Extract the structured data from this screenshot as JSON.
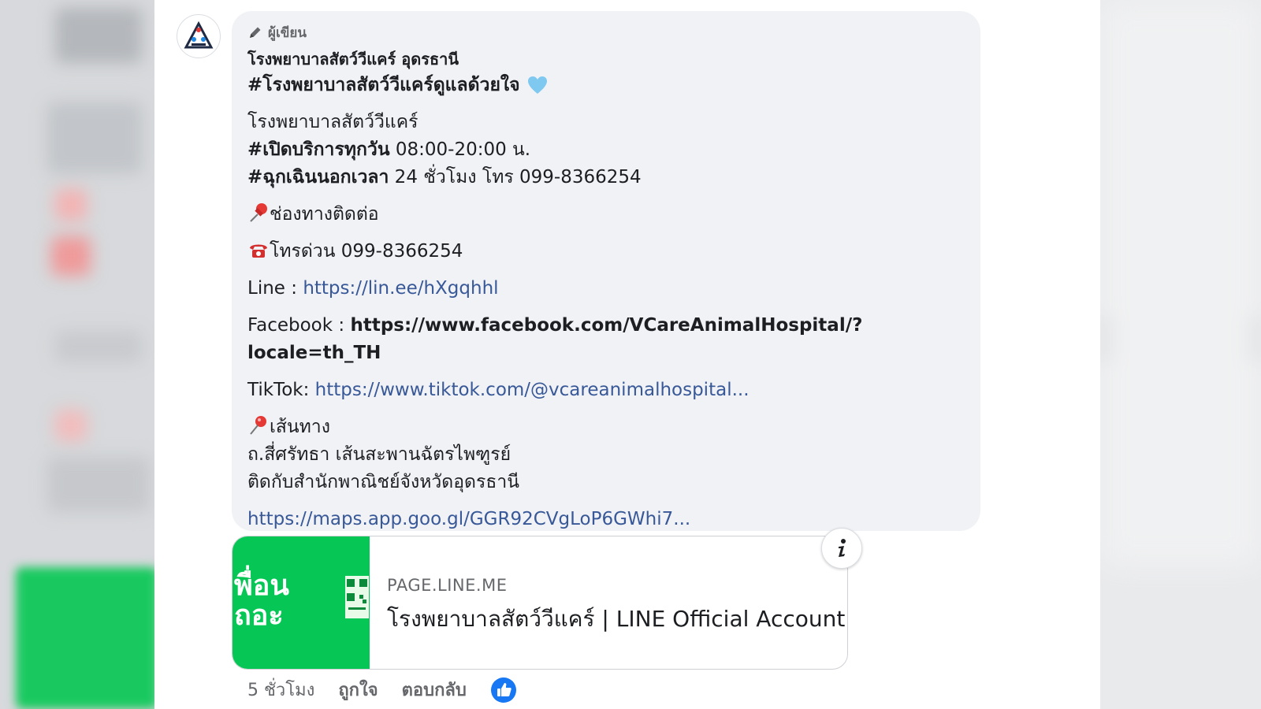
{
  "post": {
    "author_label": "ผู้เขียน",
    "author_name": "โรงพยาบาลสัตว์วีแคร์ อุดรธานี",
    "hashtag_heading": "#โรงพยาบาลสัตว์วีแคร์ดูแลด้วยใจ",
    "hospital_name": "โรงพยาบาลสัตว์วีแคร์",
    "hours_tag": "#เปิดบริการทุกวัน",
    "hours_value": " 08:00-20:00 น.",
    "emergency_tag": "#ฉุกเฉินนอกเวลา",
    "emergency_value": " 24 ชั่วโมง โทร 099-8366254",
    "contact_heading": "ช่องทางติดต่อ",
    "hotline": "โทรด่วน 099-8366254",
    "line_label": "Line : ",
    "line_link": "https://lin.ee/hXgqhhl",
    "facebook_label": "Facebook : ",
    "facebook_link": "https://www.facebook.com/VCareAnimalHospital/?locale=th_TH",
    "tiktok_label": "TikTok: ",
    "tiktok_link": "https://www.tiktok.com/@vcareanimalhospital...",
    "directions_heading": "เส้นทาง",
    "address_line1": "ถ.สี่ศรัทธา เส้นสะพานฉัตรไพฑูรย์",
    "address_line2": "ติดกับสำนักพาณิชย์จังหวัดอุดรธานี",
    "maps_link": "https://maps.app.goo.gl/GGR92CVgLoP6GWhi7..."
  },
  "link_card": {
    "thumb_text1": "พื่อน",
    "thumb_text2": "ถอะ",
    "domain": "PAGE.LINE.ME",
    "title": "โรงพยาบาลสัตว์วีแคร์ | LINE Official Account"
  },
  "actions": {
    "time": "5 ชั่วโมง",
    "like": "ถูกใจ",
    "reply": "ตอบกลับ"
  },
  "colors": {
    "link": "#385898",
    "line_green": "#06c755",
    "like_blue": "#1877f2"
  }
}
